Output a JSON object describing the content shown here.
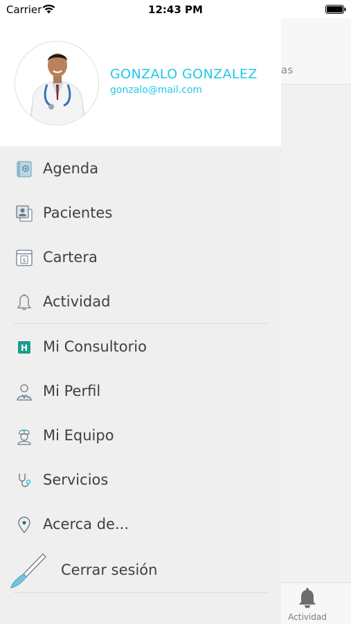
{
  "status_bar": {
    "carrier": "Carrier",
    "time": "12:43 PM",
    "icons": [
      "wifi-icon",
      "battery-icon"
    ]
  },
  "background_app": {
    "tab_fragment": "as",
    "tabbar_label": "Actividad",
    "tabbar_icon": "bell-icon"
  },
  "profile": {
    "name": "GONZALO GONZALEZ",
    "email": "gonzalo@mail.com",
    "avatar": "doctor-avatar"
  },
  "menu": {
    "items": [
      {
        "label": "Agenda",
        "icon": "agenda-icon"
      },
      {
        "label": "Pacientes",
        "icon": "patients-icon"
      },
      {
        "label": "Cartera",
        "icon": "wallet-icon"
      },
      {
        "label": "Actividad",
        "icon": "bell-icon"
      },
      {
        "label": "Mi Consultorio",
        "icon": "hospital-icon"
      },
      {
        "label": "Mi Perfil",
        "icon": "doctor-profile-icon"
      },
      {
        "label": "Mi Equipo",
        "icon": "nurse-icon"
      },
      {
        "label": "Servicios",
        "icon": "stethoscope-icon"
      },
      {
        "label": "Acerca de...",
        "icon": "location-pin-icon"
      }
    ],
    "logout_label": "Cerrar sesión",
    "logout_icon": "scalpel-icon"
  },
  "colors": {
    "accent": "#1ec9e8",
    "drawer_bg": "#efefef",
    "text": "#3f3f3f",
    "hospital_green": "#1a9e8a"
  }
}
